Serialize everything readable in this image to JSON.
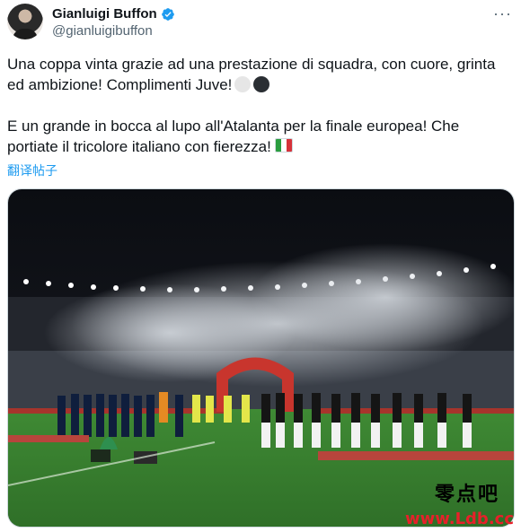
{
  "author": {
    "display_name": "Gianluigi Buffon",
    "handle": "@gianluigibuffon",
    "verified": true,
    "avatar_icon": "profile-photo"
  },
  "more_label": "···",
  "tweet": {
    "paragraph1": "Una coppa vinta grazie ad una prestazione di squadra, con cuore, grinta ed ambizione! Complimenti Juve!",
    "paragraph1_emoji": [
      "white-circle",
      "black-circle"
    ],
    "paragraph2": "E un grande in bocca al lupo all'Atalanta per la finale europea! Che portiate il tricolore italiano con fierezza!",
    "paragraph2_emoji": "italy-flag"
  },
  "translate_label": "翻译帖子",
  "media": {
    "type": "photo",
    "description_icon": "stadium-team-lineup-photo"
  },
  "watermark": {
    "chinese": "零点吧",
    "url": "www.Ldb.cc"
  },
  "colors": {
    "link": "#1d9bf0",
    "verified": "#1d9bf0",
    "watermark_url": "#e8202a",
    "secondary_text": "#536471"
  }
}
